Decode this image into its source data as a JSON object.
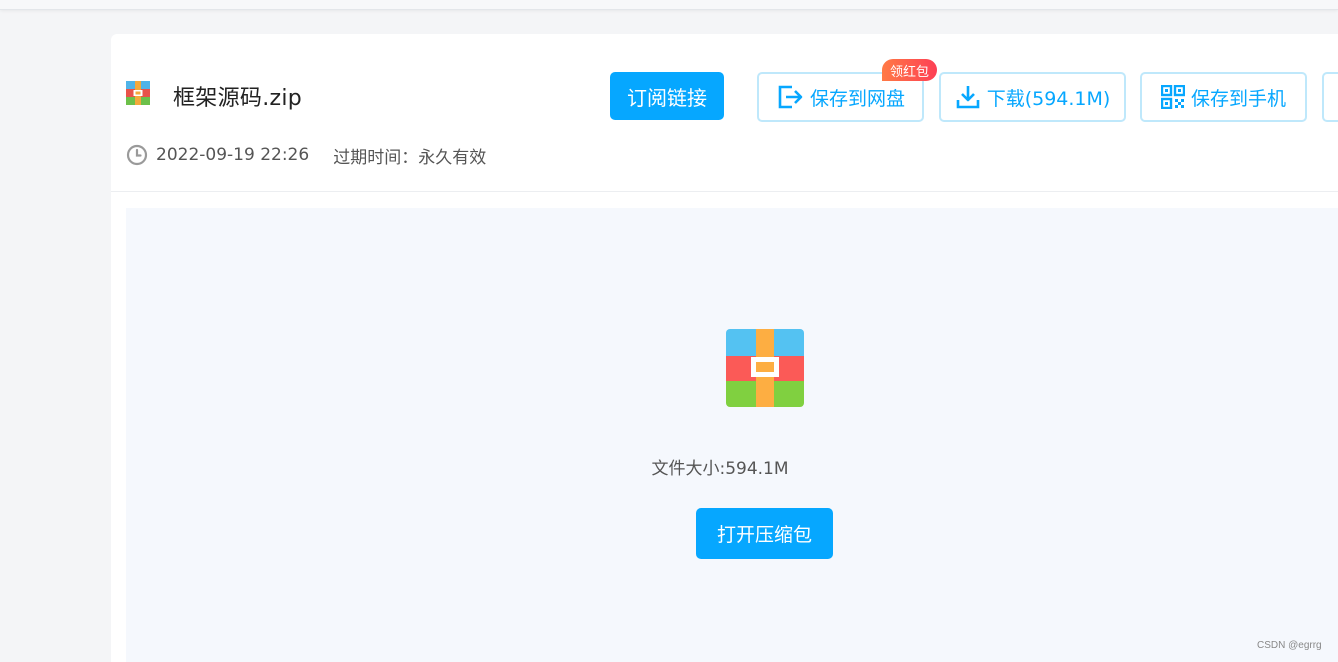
{
  "file": {
    "name": "框架源码.zip",
    "date": "2022-09-19 22:26",
    "expire_label": "过期时间：",
    "expire_value": "永久有效",
    "icon": "zip-archive-icon"
  },
  "toolbar": {
    "subscribe_label": "订阅链接",
    "save_label": "保存到网盘",
    "save_badge": "领红包",
    "download_label": "下载(594.1M)",
    "phone_label": "保存到手机"
  },
  "preview": {
    "size_text": "文件大小:594.1M",
    "open_label": "打开压缩包"
  },
  "watermark": "CSDN @egrrg",
  "colors": {
    "accent": "#06a7ff",
    "accent_border": "#bfe8fb",
    "badge": "#fd4c5c",
    "preview_bg": "#f5f8fd"
  }
}
